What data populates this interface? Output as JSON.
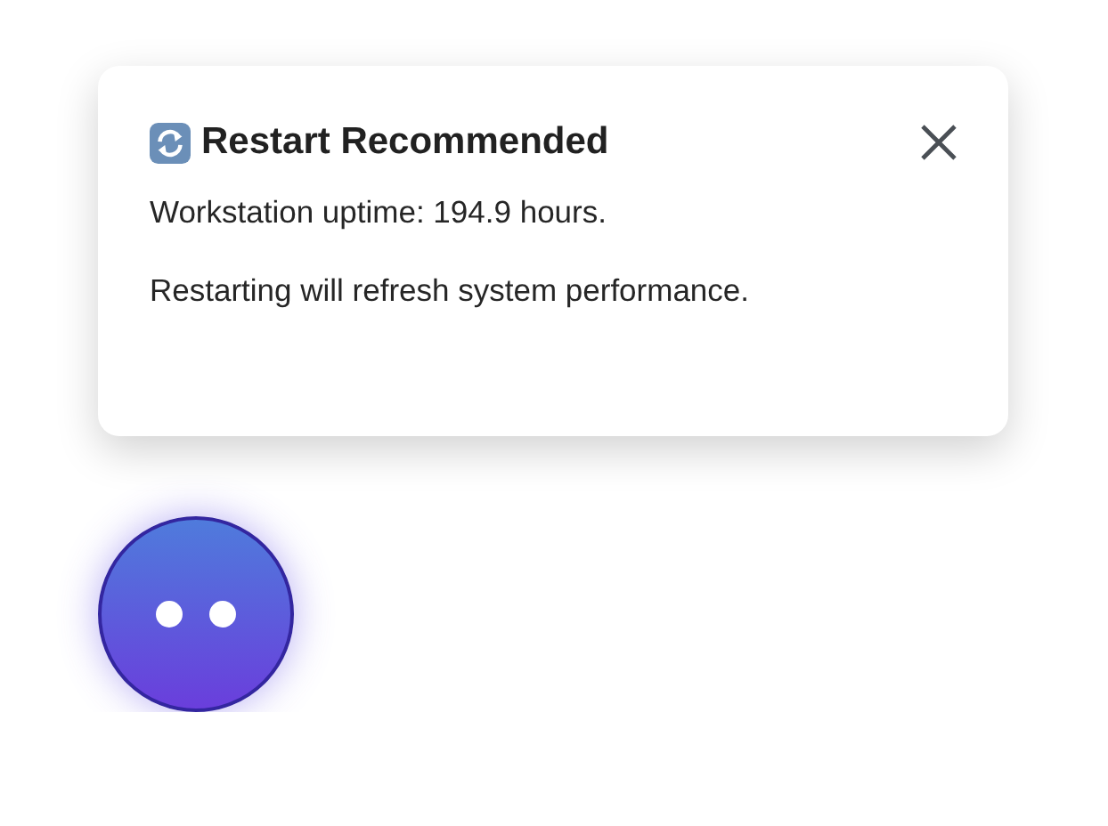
{
  "notification": {
    "title": "Restart Recommended",
    "lines": [
      "Workstation uptime: 194.9 hours.",
      "Restarting will refresh system performance."
    ]
  }
}
